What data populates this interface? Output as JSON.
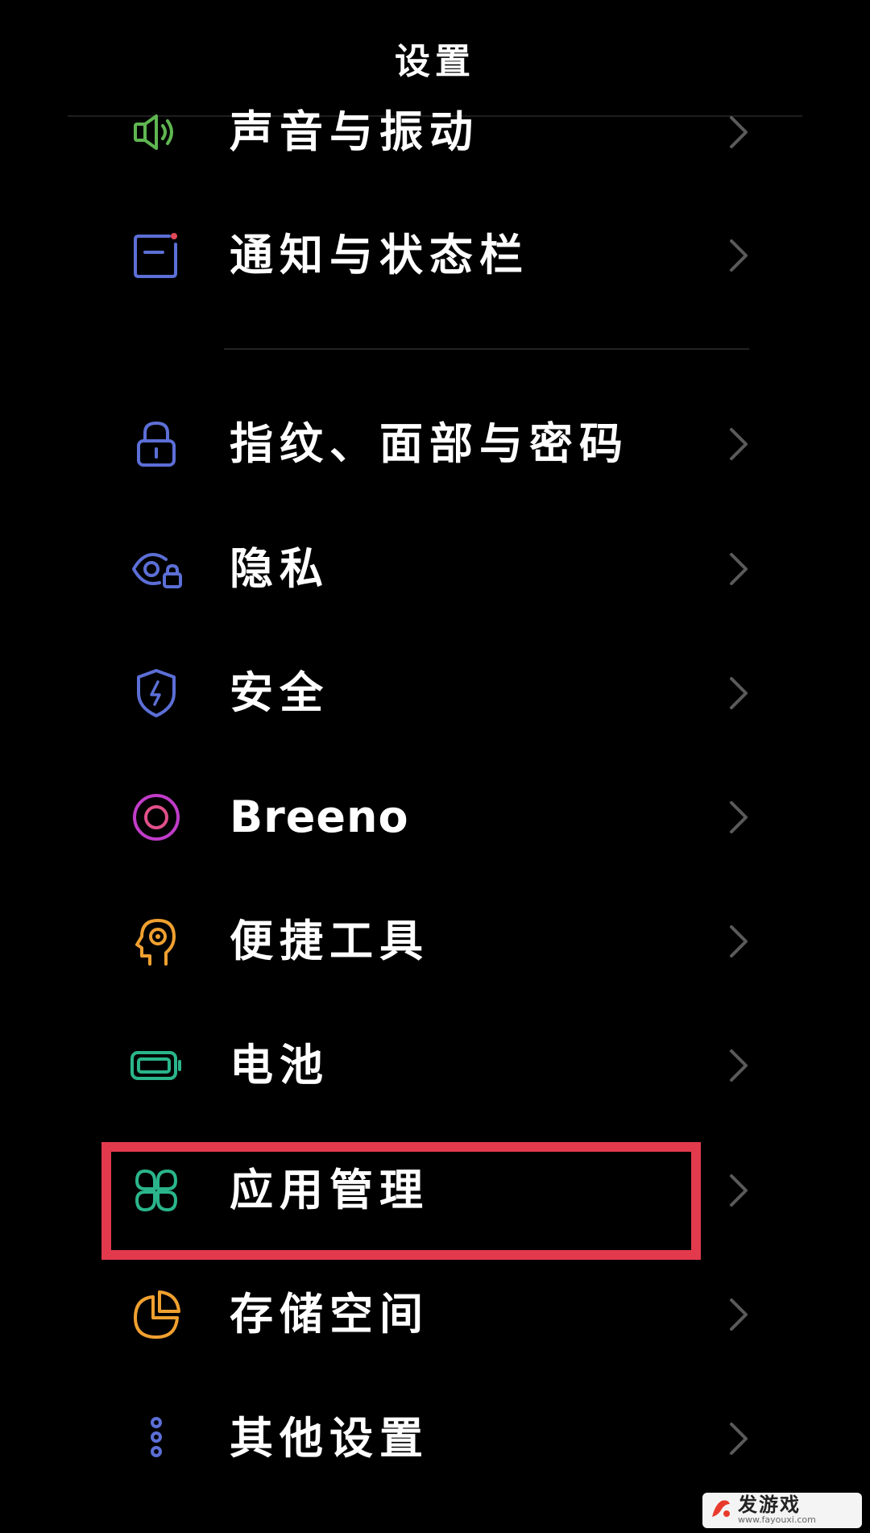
{
  "header": {
    "title": "设置"
  },
  "items": [
    {
      "id": "sound",
      "label": "声音与振动",
      "icon": "speaker-icon",
      "color": "#5fb651"
    },
    {
      "id": "notify",
      "label": "通知与状态栏",
      "icon": "notification-icon",
      "color": "#5c6fd6"
    },
    {
      "id": "biometric",
      "label": "指纹、面部与密码",
      "icon": "lock-icon",
      "color": "#5c6fd6"
    },
    {
      "id": "privacy",
      "label": "隐私",
      "icon": "privacy-eye-icon",
      "color": "#5c6fd6"
    },
    {
      "id": "security",
      "label": "安全",
      "icon": "shield-icon",
      "color": "#5c6fd6"
    },
    {
      "id": "breeno",
      "label": "Breeno",
      "icon": "breeno-icon",
      "color": "#c03cc8"
    },
    {
      "id": "tools",
      "label": "便捷工具",
      "icon": "head-tools-icon",
      "color": "#f0a030"
    },
    {
      "id": "battery",
      "label": "电池",
      "icon": "battery-icon",
      "color": "#2ab58a"
    },
    {
      "id": "apps",
      "label": "应用管理",
      "icon": "app-grid-icon",
      "color": "#2ab58a"
    },
    {
      "id": "storage",
      "label": "存储空间",
      "icon": "pie-chart-icon",
      "color": "#f0a030"
    },
    {
      "id": "other",
      "label": "其他设置",
      "icon": "more-dots-icon",
      "color": "#5c6fd6"
    }
  ],
  "highlight": {
    "color": "#e23a4c",
    "target": "应用管理"
  },
  "watermark": {
    "text": "发游戏",
    "url": "www.fayouxi.com",
    "accent": "#e83a2a"
  }
}
